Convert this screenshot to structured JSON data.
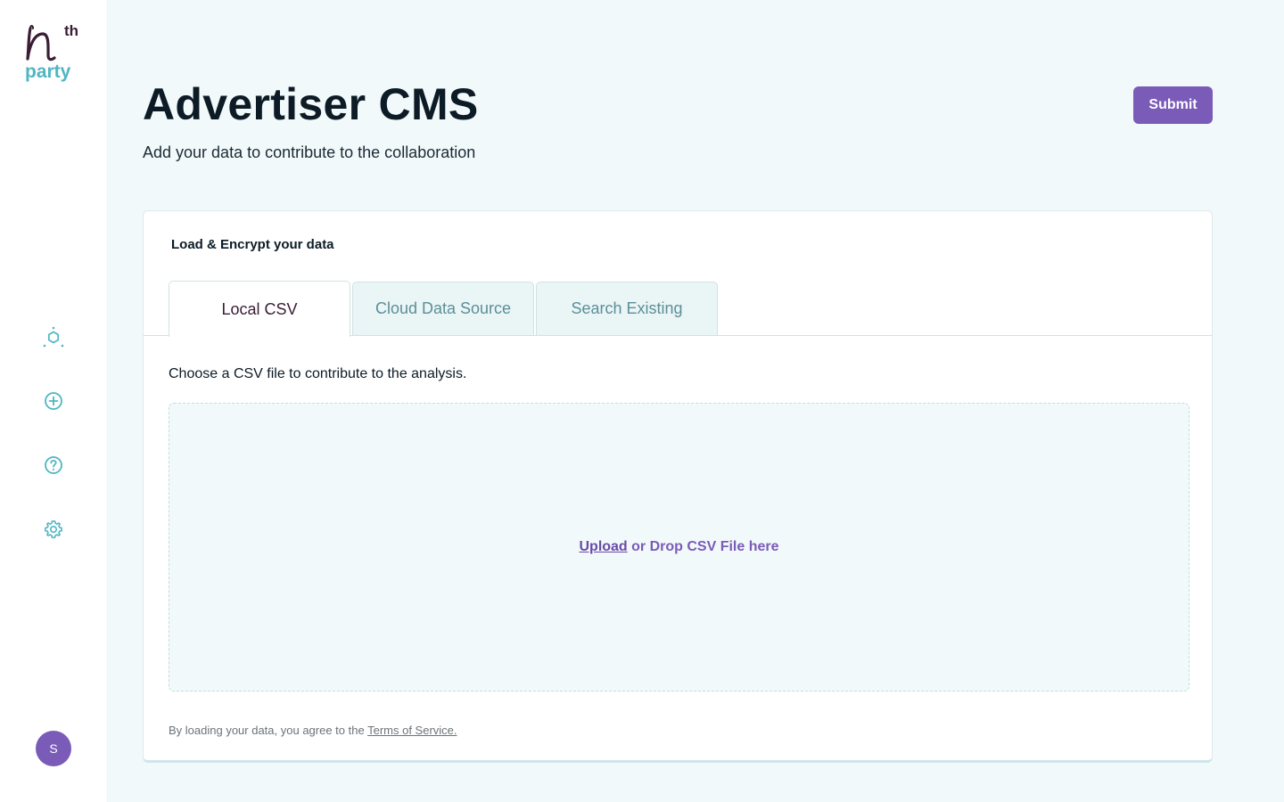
{
  "brand": {
    "logo_mark": "n",
    "logo_sup": "th",
    "logo_word": "party"
  },
  "sidebar": {
    "icons": [
      {
        "name": "hexagon-nodes-icon"
      },
      {
        "name": "plus-circle-icon"
      },
      {
        "name": "help-circle-icon"
      },
      {
        "name": "gear-icon"
      }
    ],
    "avatar_initial": "S"
  },
  "header": {
    "title": "Advertiser CMS",
    "subtitle": "Add your data to contribute to the collaboration",
    "submit_label": "Submit"
  },
  "card": {
    "title": "Load & Encrypt your data",
    "tabs": [
      {
        "label": "Local CSV",
        "active": true
      },
      {
        "label": "Cloud Data Source",
        "active": false
      },
      {
        "label": "Search Existing",
        "active": false
      }
    ],
    "instruction": "Choose a CSV file to contribute to the analysis.",
    "dropzone": {
      "upload_link": "Upload",
      "rest_text": " or Drop CSV File here"
    },
    "footnote": {
      "prefix": "By loading your data, you agree to the ",
      "link": "Terms of Service."
    }
  },
  "colors": {
    "accent": "#7a5bb8",
    "teal": "#4fb6c2",
    "logo_dark": "#3a1d33",
    "background": "#f2f9fa"
  }
}
